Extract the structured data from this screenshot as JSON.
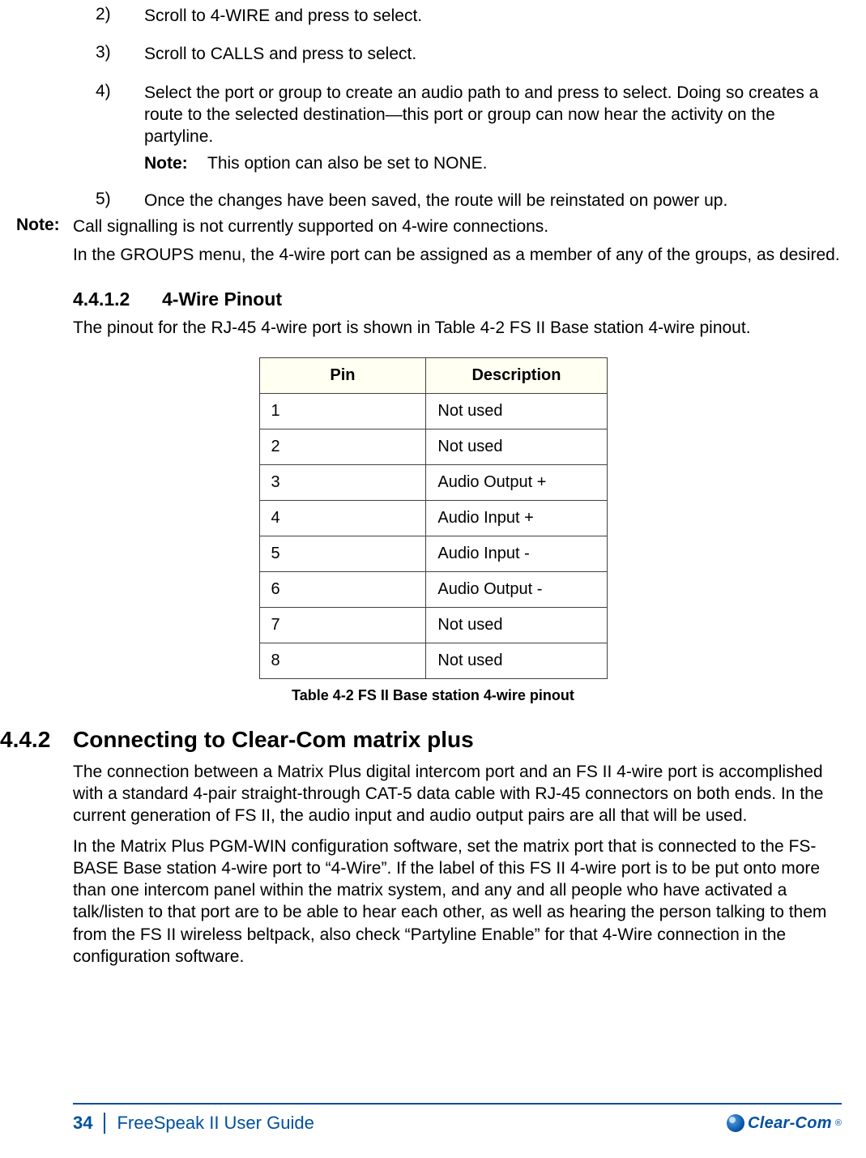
{
  "steps": {
    "s2": {
      "num": "2)",
      "text": "Scroll to 4-WIRE and press to select."
    },
    "s3": {
      "num": "3)",
      "text": "Scroll to CALLS and press to select."
    },
    "s4": {
      "num": "4)",
      "text": "Select the port or group to create an audio path to and press to select. Doing so creates a route to the selected destination—this port or group can now hear the activity on the partyline.",
      "note_label": "Note:",
      "note_text": "This option can also be set to NONE."
    },
    "s5": {
      "num": "5)",
      "text": "Once the changes have been saved, the route will be reinstated on power up."
    }
  },
  "outer_note": {
    "label": "Note:",
    "line1": "Call signalling is not currently supported on 4-wire connections.",
    "line2": "In the GROUPS menu, the 4-wire port can be assigned as a member of any of the groups, as desired."
  },
  "section_4412": {
    "num": "4.4.1.2",
    "title": "4-Wire Pinout",
    "intro": "The pinout for the RJ-45 4-wire port is shown in Table 4-2 FS II Base station 4-wire pinout."
  },
  "table": {
    "headers": {
      "pin": "Pin",
      "desc": "Description"
    },
    "rows": [
      {
        "pin": "1",
        "desc": "Not used"
      },
      {
        "pin": "2",
        "desc": "Not used"
      },
      {
        "pin": "3",
        "desc": "Audio Output +"
      },
      {
        "pin": "4",
        "desc": "Audio Input +"
      },
      {
        "pin": "5",
        "desc": "Audio Input -"
      },
      {
        "pin": "6",
        "desc": "Audio Output -"
      },
      {
        "pin": "7",
        "desc": "Not used"
      },
      {
        "pin": "8",
        "desc": "Not used"
      }
    ],
    "caption": "Table 4-2 FS II Base station 4-wire pinout"
  },
  "section_442": {
    "num": "4.4.2",
    "title": "Connecting to Clear-Com matrix plus",
    "para1": "The connection between a Matrix Plus digital intercom port and an FS II 4-wire port is accomplished with a standard 4-pair straight-through CAT-5 data cable with RJ-45 connectors on both ends. In the current generation of FS II, the audio input and audio output pairs are all that will be used.",
    "para2": "In the Matrix Plus PGM-WIN configuration software, set the matrix port that is connected to the FS-BASE Base station 4-wire port to “4-Wire”. If the label of this FS II 4-wire port is to be put onto more than one intercom panel within the matrix system, and any and all people who have activated a talk/listen to that port are to be able to hear each other, as well as hearing the person talking to them from the FS II wireless beltpack, also check “Partyline Enable” for that 4-Wire connection in the configuration software."
  },
  "footer": {
    "page": "34",
    "title": "FreeSpeak II User Guide",
    "brand": "Clear-Com",
    "reg": "®"
  }
}
